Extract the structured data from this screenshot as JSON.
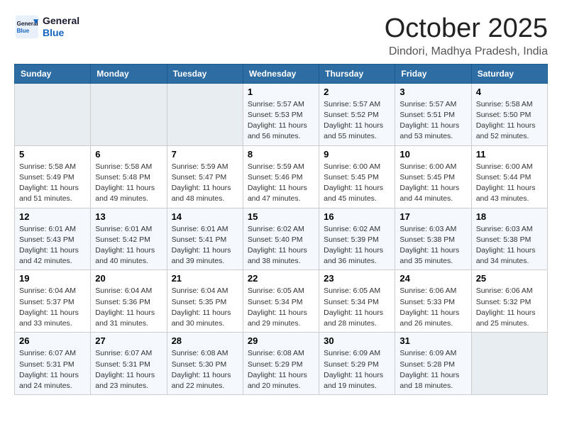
{
  "header": {
    "logo_general": "General",
    "logo_blue": "Blue",
    "month": "October 2025",
    "location": "Dindori, Madhya Pradesh, India"
  },
  "weekdays": [
    "Sunday",
    "Monday",
    "Tuesday",
    "Wednesday",
    "Thursday",
    "Friday",
    "Saturday"
  ],
  "weeks": [
    [
      {
        "day": "",
        "info": ""
      },
      {
        "day": "",
        "info": ""
      },
      {
        "day": "",
        "info": ""
      },
      {
        "day": "1",
        "info": "Sunrise: 5:57 AM\nSunset: 5:53 PM\nDaylight: 11 hours and 56 minutes."
      },
      {
        "day": "2",
        "info": "Sunrise: 5:57 AM\nSunset: 5:52 PM\nDaylight: 11 hours and 55 minutes."
      },
      {
        "day": "3",
        "info": "Sunrise: 5:57 AM\nSunset: 5:51 PM\nDaylight: 11 hours and 53 minutes."
      },
      {
        "day": "4",
        "info": "Sunrise: 5:58 AM\nSunset: 5:50 PM\nDaylight: 11 hours and 52 minutes."
      }
    ],
    [
      {
        "day": "5",
        "info": "Sunrise: 5:58 AM\nSunset: 5:49 PM\nDaylight: 11 hours and 51 minutes."
      },
      {
        "day": "6",
        "info": "Sunrise: 5:58 AM\nSunset: 5:48 PM\nDaylight: 11 hours and 49 minutes."
      },
      {
        "day": "7",
        "info": "Sunrise: 5:59 AM\nSunset: 5:47 PM\nDaylight: 11 hours and 48 minutes."
      },
      {
        "day": "8",
        "info": "Sunrise: 5:59 AM\nSunset: 5:46 PM\nDaylight: 11 hours and 47 minutes."
      },
      {
        "day": "9",
        "info": "Sunrise: 6:00 AM\nSunset: 5:45 PM\nDaylight: 11 hours and 45 minutes."
      },
      {
        "day": "10",
        "info": "Sunrise: 6:00 AM\nSunset: 5:45 PM\nDaylight: 11 hours and 44 minutes."
      },
      {
        "day": "11",
        "info": "Sunrise: 6:00 AM\nSunset: 5:44 PM\nDaylight: 11 hours and 43 minutes."
      }
    ],
    [
      {
        "day": "12",
        "info": "Sunrise: 6:01 AM\nSunset: 5:43 PM\nDaylight: 11 hours and 42 minutes."
      },
      {
        "day": "13",
        "info": "Sunrise: 6:01 AM\nSunset: 5:42 PM\nDaylight: 11 hours and 40 minutes."
      },
      {
        "day": "14",
        "info": "Sunrise: 6:01 AM\nSunset: 5:41 PM\nDaylight: 11 hours and 39 minutes."
      },
      {
        "day": "15",
        "info": "Sunrise: 6:02 AM\nSunset: 5:40 PM\nDaylight: 11 hours and 38 minutes."
      },
      {
        "day": "16",
        "info": "Sunrise: 6:02 AM\nSunset: 5:39 PM\nDaylight: 11 hours and 36 minutes."
      },
      {
        "day": "17",
        "info": "Sunrise: 6:03 AM\nSunset: 5:38 PM\nDaylight: 11 hours and 35 minutes."
      },
      {
        "day": "18",
        "info": "Sunrise: 6:03 AM\nSunset: 5:38 PM\nDaylight: 11 hours and 34 minutes."
      }
    ],
    [
      {
        "day": "19",
        "info": "Sunrise: 6:04 AM\nSunset: 5:37 PM\nDaylight: 11 hours and 33 minutes."
      },
      {
        "day": "20",
        "info": "Sunrise: 6:04 AM\nSunset: 5:36 PM\nDaylight: 11 hours and 31 minutes."
      },
      {
        "day": "21",
        "info": "Sunrise: 6:04 AM\nSunset: 5:35 PM\nDaylight: 11 hours and 30 minutes."
      },
      {
        "day": "22",
        "info": "Sunrise: 6:05 AM\nSunset: 5:34 PM\nDaylight: 11 hours and 29 minutes."
      },
      {
        "day": "23",
        "info": "Sunrise: 6:05 AM\nSunset: 5:34 PM\nDaylight: 11 hours and 28 minutes."
      },
      {
        "day": "24",
        "info": "Sunrise: 6:06 AM\nSunset: 5:33 PM\nDaylight: 11 hours and 26 minutes."
      },
      {
        "day": "25",
        "info": "Sunrise: 6:06 AM\nSunset: 5:32 PM\nDaylight: 11 hours and 25 minutes."
      }
    ],
    [
      {
        "day": "26",
        "info": "Sunrise: 6:07 AM\nSunset: 5:31 PM\nDaylight: 11 hours and 24 minutes."
      },
      {
        "day": "27",
        "info": "Sunrise: 6:07 AM\nSunset: 5:31 PM\nDaylight: 11 hours and 23 minutes."
      },
      {
        "day": "28",
        "info": "Sunrise: 6:08 AM\nSunset: 5:30 PM\nDaylight: 11 hours and 22 minutes."
      },
      {
        "day": "29",
        "info": "Sunrise: 6:08 AM\nSunset: 5:29 PM\nDaylight: 11 hours and 20 minutes."
      },
      {
        "day": "30",
        "info": "Sunrise: 6:09 AM\nSunset: 5:29 PM\nDaylight: 11 hours and 19 minutes."
      },
      {
        "day": "31",
        "info": "Sunrise: 6:09 AM\nSunset: 5:28 PM\nDaylight: 11 hours and 18 minutes."
      },
      {
        "day": "",
        "info": ""
      }
    ]
  ],
  "colors": {
    "header_bg": "#2e6da4",
    "row_odd": "#f5f8fc",
    "row_even": "#ffffff",
    "empty_bg": "#e8edf2"
  }
}
